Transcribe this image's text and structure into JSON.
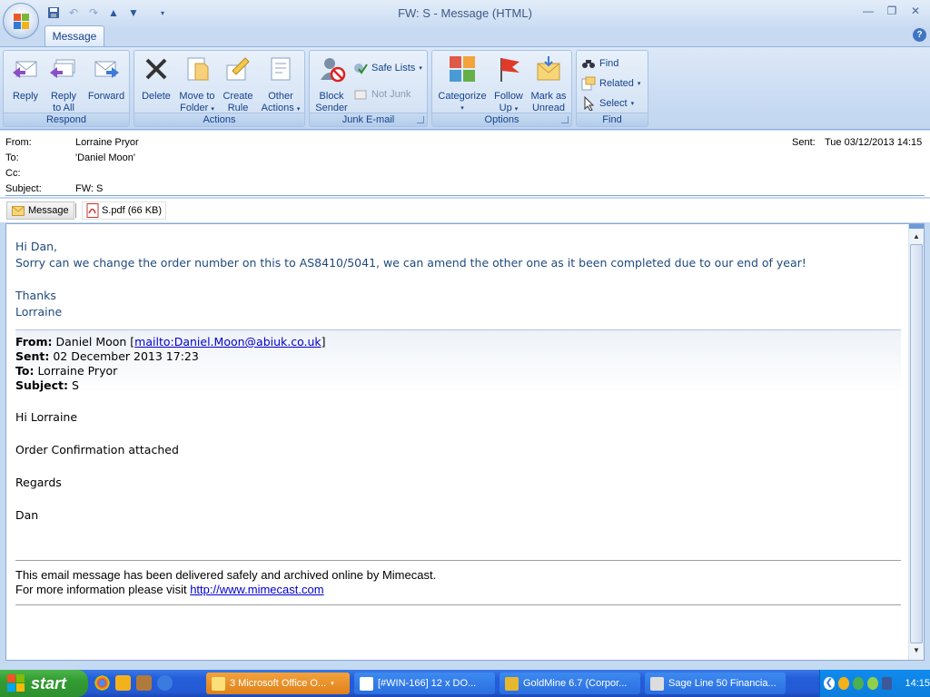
{
  "window": {
    "title": "FW: S  -  Message (HTML)"
  },
  "tabs": [
    {
      "label": "Message"
    }
  ],
  "ribbon": {
    "respond": {
      "label": "Respond",
      "reply": "Reply",
      "reply_all_1": "Reply",
      "reply_all_2": "to All",
      "forward": "Forward"
    },
    "actions": {
      "label": "Actions",
      "delete": "Delete",
      "move_1": "Move to",
      "move_2": "Folder",
      "rule_1": "Create",
      "rule_2": "Rule",
      "other_1": "Other",
      "other_2": "Actions"
    },
    "junk": {
      "label": "Junk E-mail",
      "block_1": "Block",
      "block_2": "Sender",
      "safe_lists": "Safe Lists",
      "not_junk": "Not Junk"
    },
    "options": {
      "label": "Options",
      "categorize": "Categorize",
      "follow_1": "Follow",
      "follow_2": "Up",
      "mark_1": "Mark as",
      "mark_2": "Unread"
    },
    "find": {
      "label": "Find",
      "find": "Find",
      "related": "Related",
      "select": "Select"
    }
  },
  "header": {
    "from_label": "From:",
    "from": "Lorraine Pryor",
    "to_label": "To:",
    "to": "'Daniel Moon'",
    "cc_label": "Cc:",
    "cc": "",
    "subject_label": "Subject:",
    "subject": "FW: S",
    "sent_label": "Sent:",
    "sent": "Tue 03/12/2013 14:15"
  },
  "attachments": {
    "message": "Message",
    "file": "S.pdf (66 KB)"
  },
  "body": {
    "greeting": "Hi Dan,",
    "line1": "Sorry can we change the order number on this to AS8410/5041, we can amend the other one as it been completed due to our end of year!",
    "thanks": "Thanks",
    "signature": "Lorraine",
    "orig": {
      "from_label": "From:",
      "from_name": "Daniel Moon [",
      "from_link": "mailto:Daniel.Moon@abiuk.co.uk",
      "from_end": "]",
      "sent_label": "Sent:",
      "sent": "02 December 2013 17:23",
      "to_label": "To:",
      "to": "Lorraine Pryor",
      "subject_label": "Subject:",
      "subject": "S",
      "greeting": "Hi Lorraine",
      "line1": "Order Confirmation attached",
      "regards": "Regards",
      "name": "Dan"
    },
    "footer1": "This email message has been delivered safely and archived online by Mimecast.",
    "footer2": "For more information please visit ",
    "footer_link": "http://www.mimecast.com"
  },
  "taskbar": {
    "start": "start",
    "tasks": [
      {
        "label": "3 Microsoft Office O..."
      },
      {
        "label": "[#WIN-166] 12 x DO..."
      },
      {
        "label": "GoldMine 6.7 (Corpor..."
      },
      {
        "label": "Sage Line 50 Financia..."
      }
    ],
    "clock": "14:15"
  },
  "colors": {
    "accent": "#15428b",
    "body_text": "#1f497d",
    "taskbar": "#245ed9",
    "start": "#329c32"
  }
}
